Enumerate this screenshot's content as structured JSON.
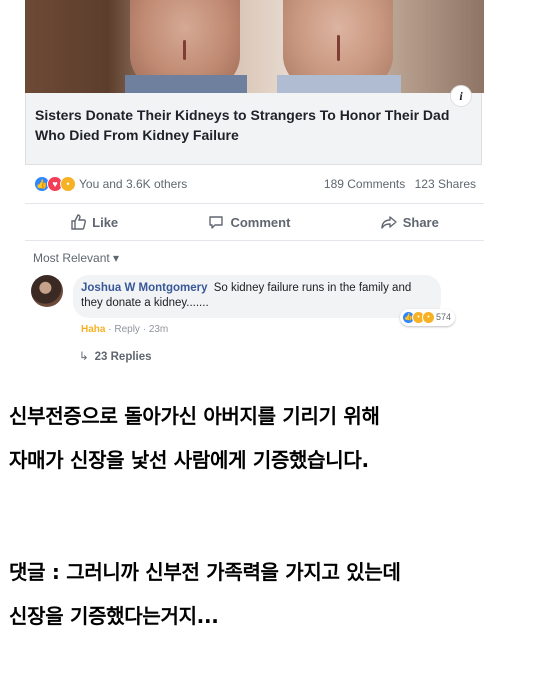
{
  "post": {
    "headline": "Sisters Donate Their Kidneys to Strangers To Honor Their Dad Who Died From Kidney Failure",
    "info_badge": "i",
    "reactions_summary": "You and 3.6K others",
    "comments_count": "189 Comments",
    "shares_count": "123 Shares",
    "reaction_icons": [
      "like-icon",
      "love-icon",
      "wow-icon"
    ],
    "actions": {
      "like": "Like",
      "comment": "Comment",
      "share": "Share"
    },
    "sort_label": "Most Relevant ▾"
  },
  "comment": {
    "author": "Joshua W Montgomery",
    "text": "So kidney failure runs in the family and they donate a kidney.......",
    "reaction_label": "Haha",
    "reply_label": "Reply",
    "time": "23m",
    "separator": " · ",
    "reaction_count": "574",
    "replies": "23 Replies"
  },
  "caption": {
    "line1": "신부전증으로 돌아가신 아버지를 기리기 위해",
    "line2": "자매가 신장을 낯선 사람에게 기증했습니다.",
    "line3": "댓글 : 그러니까 신부전 가족력을 가지고 있는데",
    "line4": "신장을 기증했다는거지..."
  },
  "colors": {
    "link_blue": "#385898",
    "like_blue": "#2d88ff",
    "love_red": "#f33e58",
    "haha_yellow": "#f7b125",
    "meta_gray": "#606770",
    "bubble_bg": "#f2f3f5"
  }
}
